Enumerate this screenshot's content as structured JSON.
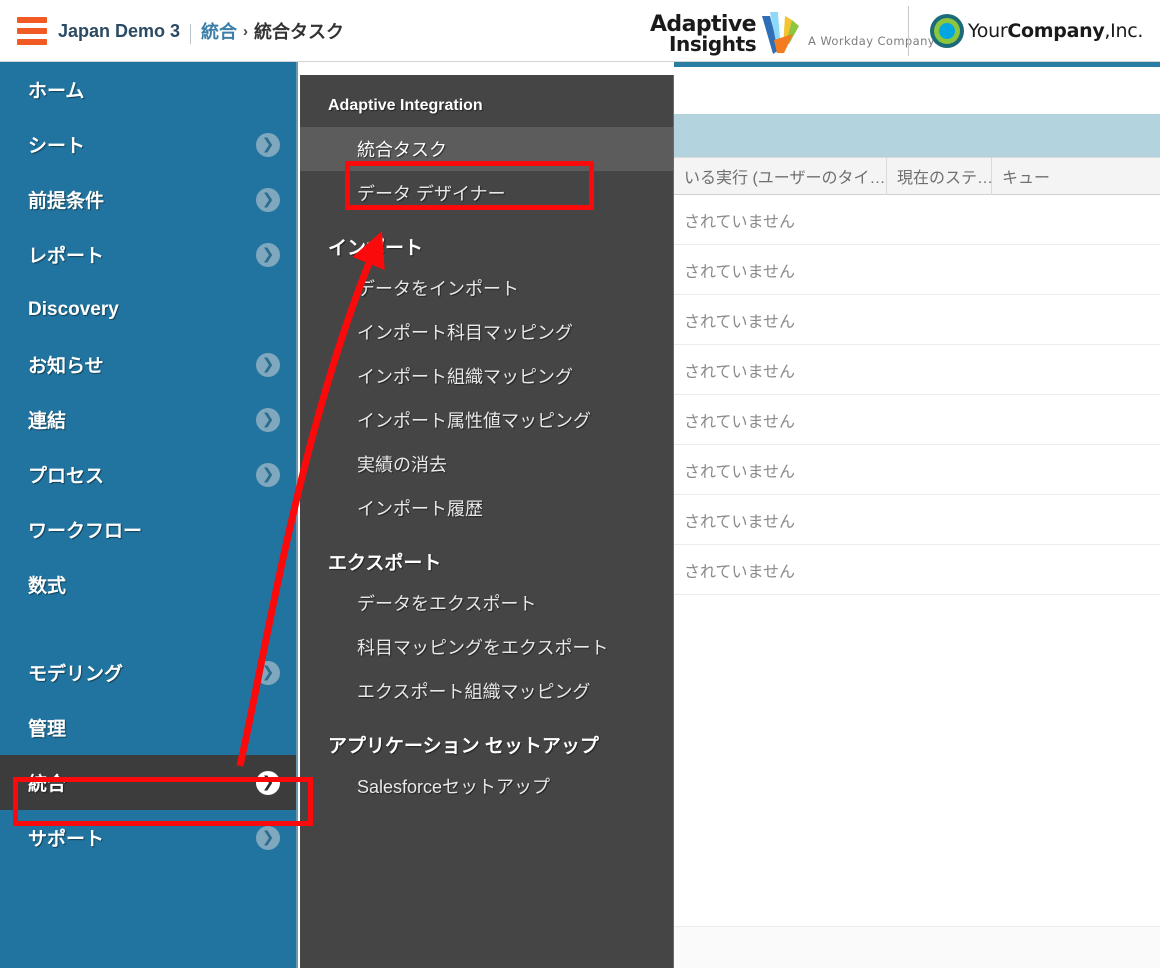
{
  "header": {
    "menu_icon": "hamburger-icon",
    "tenant": "Japan Demo 3",
    "breadcrumb_parent": "統合",
    "breadcrumb_separator": "›",
    "breadcrumb_current": "統合タスク",
    "brand": {
      "name_line1": "Adaptive",
      "name_line2": "Insights",
      "tagline": "A Workday Company"
    },
    "company": {
      "name_prefix": "Your",
      "name_bold": "Company",
      "name_suffix": ",Inc."
    }
  },
  "sidebar": {
    "items": [
      {
        "label": "ホーム",
        "has_chevron": false,
        "active": false
      },
      {
        "label": "シート",
        "has_chevron": true,
        "active": false
      },
      {
        "label": "前提条件",
        "has_chevron": true,
        "active": false
      },
      {
        "label": "レポート",
        "has_chevron": true,
        "active": false
      },
      {
        "label": "Discovery",
        "has_chevron": false,
        "active": false
      },
      {
        "label": "お知らせ",
        "has_chevron": true,
        "active": false
      },
      {
        "label": "連結",
        "has_chevron": true,
        "active": false
      },
      {
        "label": "プロセス",
        "has_chevron": true,
        "active": false
      },
      {
        "label": "ワークフロー",
        "has_chevron": false,
        "active": false
      },
      {
        "label": "数式",
        "has_chevron": false,
        "active": false
      },
      {
        "label": "モデリング",
        "has_chevron": true,
        "active": false
      },
      {
        "label": "管理",
        "has_chevron": false,
        "active": false
      },
      {
        "label": "統合",
        "has_chevron": true,
        "active": true
      },
      {
        "label": "サポート",
        "has_chevron": true,
        "active": false
      }
    ],
    "chevron_glyph": "❯"
  },
  "submenu": {
    "title": "Adaptive Integration",
    "top_items": [
      {
        "label": "統合タスク",
        "selected": true
      },
      {
        "label": "データ デザイナー",
        "selected": false
      }
    ],
    "groups": [
      {
        "title": "インポート",
        "items": [
          "データをインポート",
          "インポート科目マッピング",
          "インポート組織マッピング",
          "インポート属性値マッピング",
          "実績の消去",
          "インポート履歴"
        ]
      },
      {
        "title": "エクスポート",
        "items": [
          "データをエクスポート",
          "科目マッピングをエクスポート",
          "エクスポート組織マッピング"
        ]
      },
      {
        "title": "アプリケーション セットアップ",
        "items": [
          "Salesforceセットアップ"
        ]
      }
    ]
  },
  "content": {
    "table": {
      "columns": [
        "いる実行 (ユーザーのタイ…",
        "現在のステ…",
        "キュー"
      ],
      "rows": [
        [
          "されていません",
          "",
          ""
        ],
        [
          "されていません",
          "",
          ""
        ],
        [
          "されていません",
          "",
          ""
        ],
        [
          "されていません",
          "",
          ""
        ],
        [
          "されていません",
          "",
          ""
        ],
        [
          "されていません",
          "",
          ""
        ],
        [
          "されていません",
          "",
          ""
        ],
        [
          "されていません",
          "",
          ""
        ]
      ]
    }
  },
  "annotations": {
    "rect_integration_label": "統合",
    "rect_data_designer_label": "データ デザイナー",
    "arrow_color": "#fa0a0a",
    "rect_color": "#fa0a0a"
  },
  "colors": {
    "sidebar_blue": "#21749f",
    "submenu_gray": "#454545",
    "submenu_selected_gray": "#5c5c5c",
    "accent_orange": "#f15a22",
    "band_blue": "#b3d4de",
    "top_rule_teal": "#2a7ea4"
  }
}
